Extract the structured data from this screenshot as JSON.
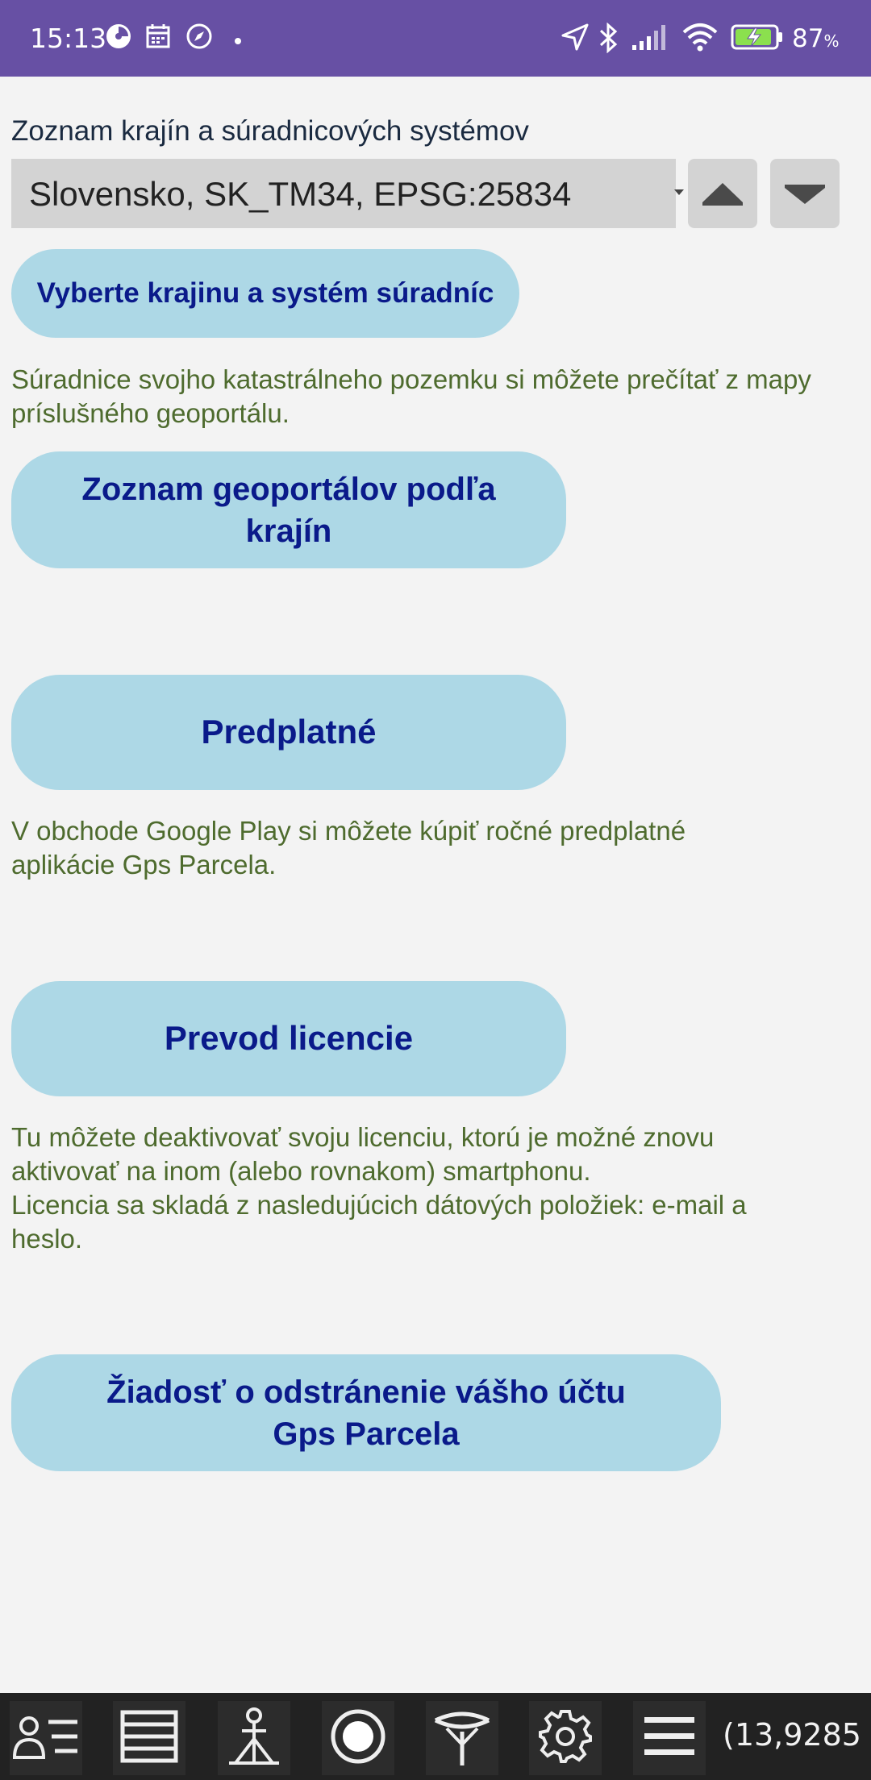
{
  "status_bar": {
    "time": "15:13",
    "battery_percent": "87",
    "battery_unit": "%",
    "icons": [
      "pinwheel-icon",
      "calendar-icon",
      "compass-icon",
      "dot-icon",
      "location-arrow-icon",
      "bluetooth-icon",
      "signal-icon",
      "wifi-icon",
      "battery-charging-icon"
    ]
  },
  "colors": {
    "status_bar": "#6750a4",
    "background": "#f3f3f3",
    "button_bg": "#add8e6",
    "button_text": "#0a1a8a",
    "note_text": "#4e6b2e",
    "select_bg": "#d3d3d3",
    "bottom_bar": "#222222"
  },
  "main": {
    "section_label": "Zoznam krajín a súradnicových systémov",
    "select_value": "Slovensko, SK_TM34, EPSG:25834",
    "select_country_button": "Vyberte krajinu a systém súradníc",
    "geoportal_note": "Súradnice svojho katastrálneho pozemku si môžete prečítať z mapy príslušného geoportálu.",
    "geoportal_button_line1": "Zoznam geoportálov podľa",
    "geoportal_button_line2": "krajín",
    "subscription_button": "Predplatné",
    "subscription_note_line1": "V obchode Google Play si môžete kúpiť ročné predplatné",
    "subscription_note_line2": "aplikácie Gps Parcela.",
    "license_button": "Prevod licencie",
    "license_note_line1": "Tu môžete deaktivovať svoju licenciu, ktorú je možné znovu",
    "license_note_line2": "aktivovať na inom (alebo rovnakom) smartphonu.",
    "license_note_line3": "Licencia sa skladá z nasledujúcich dátových položiek: e-mail a",
    "license_note_line4": "heslo.",
    "delete_button_line1": "Žiadosť o odstránenie vášho účtu",
    "delete_button_line2": "Gps Parcela"
  },
  "bottom_nav": {
    "icons": [
      "user-list-icon",
      "layers-icon",
      "survey-tripod-icon",
      "record-icon",
      "gnss-antenna-icon",
      "gear-icon",
      "menu-icon"
    ],
    "coordinate_readout": "(13,9285"
  }
}
